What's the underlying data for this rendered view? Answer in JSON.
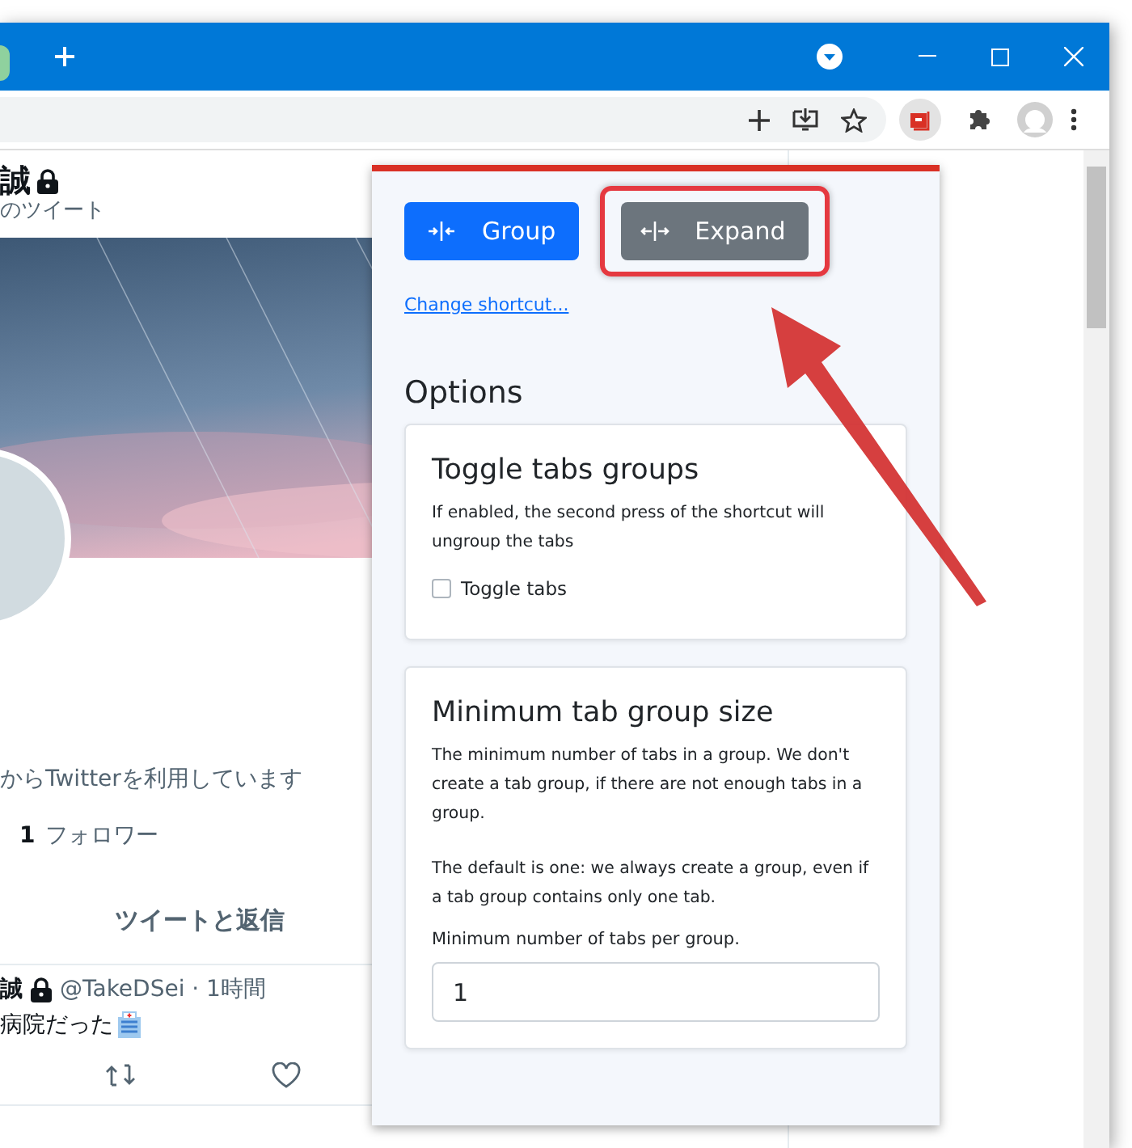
{
  "profile": {
    "name": "誠",
    "subtitle": "のツイート",
    "bio": "からTwitterを利用しています",
    "followers_count": "1",
    "followers_label": "フォロワー",
    "tab_label": "ツイートと返信"
  },
  "tweet": {
    "author": "誠",
    "meta": "@TakeDSei · 1時間",
    "text": "病院だった"
  },
  "popup": {
    "buttons": [
      {
        "label": "Group",
        "kind": "group",
        "highlighted": false
      },
      {
        "label": "Expand",
        "kind": "expand",
        "highlighted": true
      }
    ],
    "link": "Change shortcut...",
    "heading": "Options",
    "cards": [
      {
        "kind": "checkbox",
        "title": "Toggle tabs groups",
        "paragraphs": [
          "If enabled, the second press of the shortcut will ungroup the tabs"
        ],
        "checkbox": {
          "label": "Toggle tabs",
          "checked": false
        }
      },
      {
        "kind": "number",
        "title": "Minimum tab group size",
        "paragraphs": [
          "The minimum number of tabs in a group. We don't create a tab group, if there are not enough tabs in a group.",
          "The default is one: we always create a group, even if a tab group contains only one tab."
        ],
        "field_label": "Minimum number of tabs per group.",
        "value": "1"
      }
    ]
  }
}
